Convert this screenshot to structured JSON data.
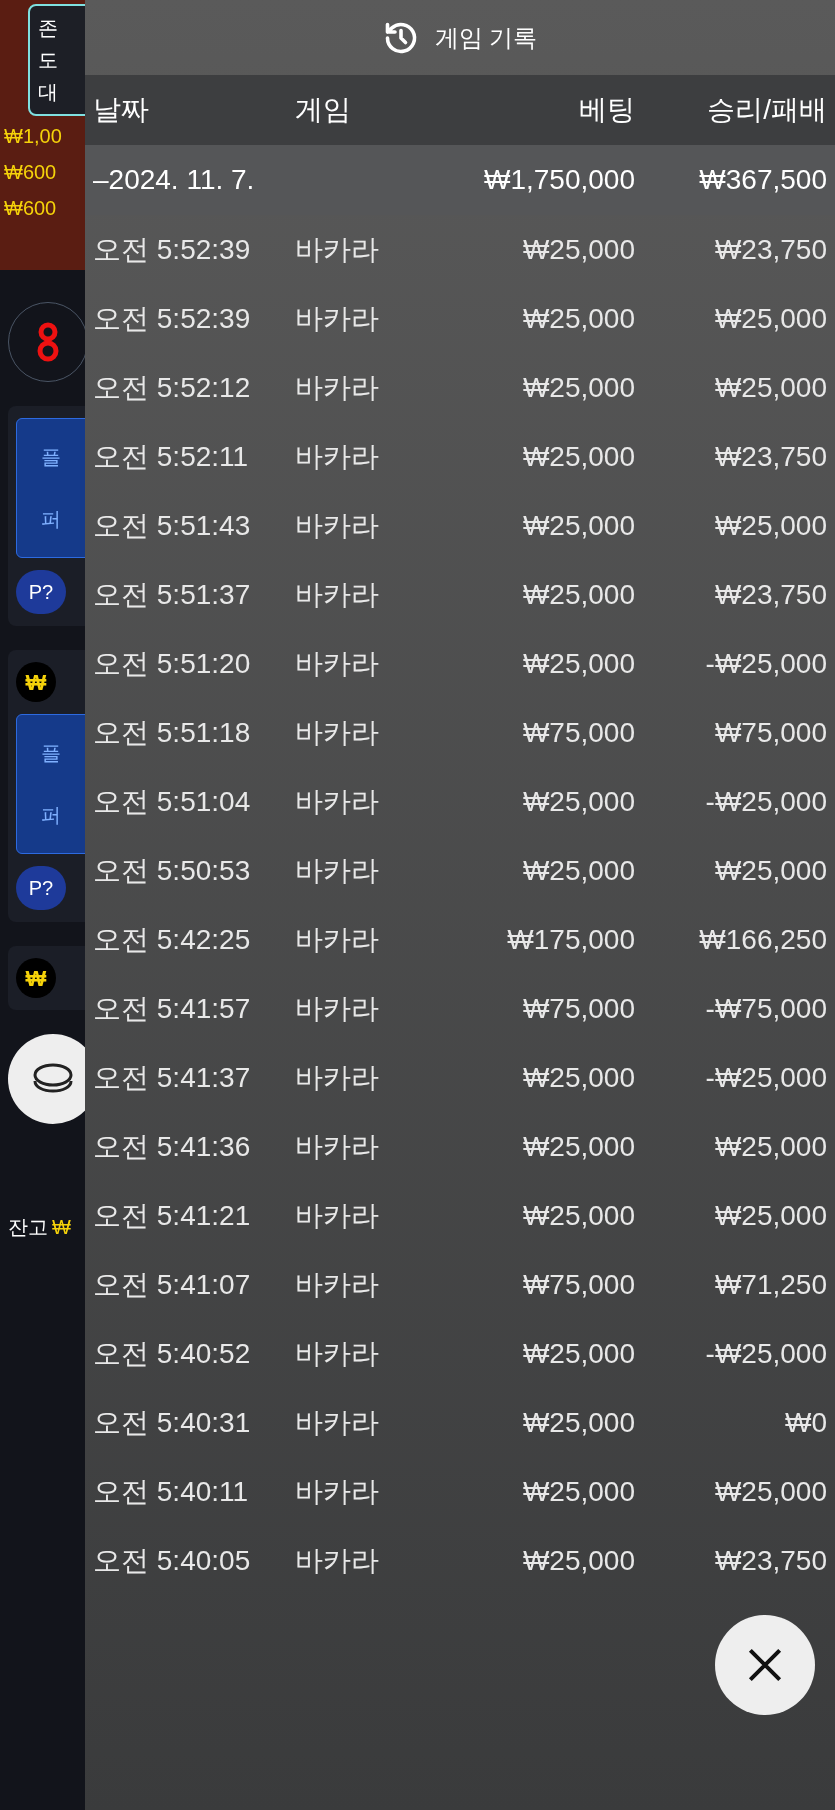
{
  "background_app": {
    "notice_lines": [
      "존",
      "도",
      "대"
    ],
    "amounts": [
      "₩1,00",
      "₩600",
      "₩600"
    ],
    "cards": [
      {
        "labels": [
          "플",
          "퍼"
        ],
        "button": "P?"
      },
      {
        "chip": "₩",
        "labels": [
          "플",
          "퍼"
        ],
        "button": "P?"
      },
      {
        "chip": "₩"
      }
    ],
    "balance_label": "잔고",
    "balance_currency": "₩"
  },
  "panel": {
    "title": "게임 기록",
    "columns": [
      "날짜",
      "게임",
      "베팅",
      "승리/패배"
    ],
    "date_group": {
      "date": "–2024. 11. 7.",
      "bet": "₩1,750,000",
      "result": "₩367,500"
    },
    "rows": [
      {
        "time": "오전 5:52:39",
        "game": "바카라",
        "bet": "₩25,000",
        "result": "₩23,750"
      },
      {
        "time": "오전 5:52:39",
        "game": "바카라",
        "bet": "₩25,000",
        "result": "₩25,000"
      },
      {
        "time": "오전 5:52:12",
        "game": "바카라",
        "bet": "₩25,000",
        "result": "₩25,000"
      },
      {
        "time": "오전 5:52:11",
        "game": "바카라",
        "bet": "₩25,000",
        "result": "₩23,750"
      },
      {
        "time": "오전 5:51:43",
        "game": "바카라",
        "bet": "₩25,000",
        "result": "₩25,000"
      },
      {
        "time": "오전 5:51:37",
        "game": "바카라",
        "bet": "₩25,000",
        "result": "₩23,750"
      },
      {
        "time": "오전 5:51:20",
        "game": "바카라",
        "bet": "₩25,000",
        "result": "-₩25,000"
      },
      {
        "time": "오전 5:51:18",
        "game": "바카라",
        "bet": "₩75,000",
        "result": "₩75,000"
      },
      {
        "time": "오전 5:51:04",
        "game": "바카라",
        "bet": "₩25,000",
        "result": "-₩25,000"
      },
      {
        "time": "오전 5:50:53",
        "game": "바카라",
        "bet": "₩25,000",
        "result": "₩25,000"
      },
      {
        "time": "오전 5:42:25",
        "game": "바카라",
        "bet": "₩175,000",
        "result": "₩166,250"
      },
      {
        "time": "오전 5:41:57",
        "game": "바카라",
        "bet": "₩75,000",
        "result": "-₩75,000"
      },
      {
        "time": "오전 5:41:37",
        "game": "바카라",
        "bet": "₩25,000",
        "result": "-₩25,000"
      },
      {
        "time": "오전 5:41:36",
        "game": "바카라",
        "bet": "₩25,000",
        "result": "₩25,000"
      },
      {
        "time": "오전 5:41:21",
        "game": "바카라",
        "bet": "₩25,000",
        "result": "₩25,000"
      },
      {
        "time": "오전 5:41:07",
        "game": "바카라",
        "bet": "₩75,000",
        "result": "₩71,250"
      },
      {
        "time": "오전 5:40:52",
        "game": "바카라",
        "bet": "₩25,000",
        "result": "-₩25,000"
      },
      {
        "time": "오전 5:40:31",
        "game": "바카라",
        "bet": "₩25,000",
        "result": "₩0"
      },
      {
        "time": "오전 5:40:11",
        "game": "바카라",
        "bet": "₩25,000",
        "result": "₩25,000"
      },
      {
        "time": "오전 5:40:05",
        "game": "바카라",
        "bet": "₩25,000",
        "result": "₩23,750"
      }
    ]
  }
}
